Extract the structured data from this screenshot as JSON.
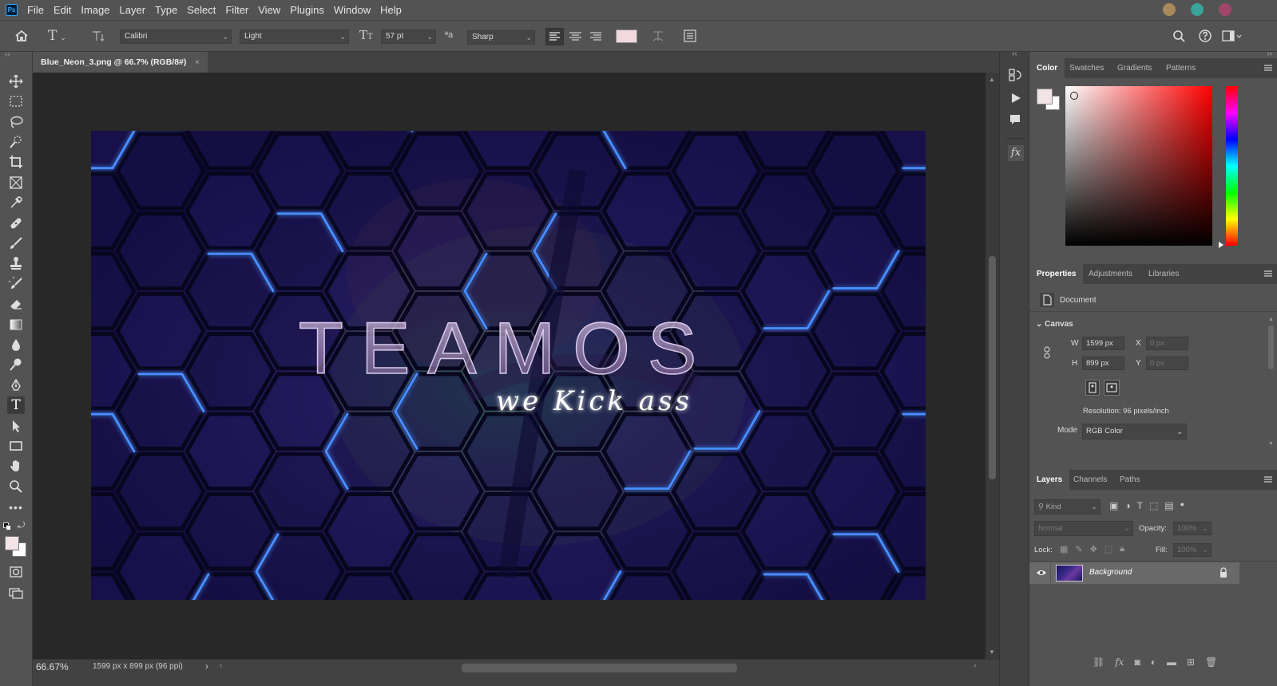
{
  "app": {
    "logo": "Ps"
  },
  "menu": [
    "File",
    "Edit",
    "Image",
    "Layer",
    "Type",
    "Select",
    "Filter",
    "View",
    "Plugins",
    "Window",
    "Help"
  ],
  "window_dots": [
    "#a88a5c",
    "#3aa39a",
    "#a1466b"
  ],
  "options": {
    "font_family": "Calibri",
    "font_style": "Light",
    "font_size": "57 pt",
    "antialias": "Sharp",
    "text_color": "#f2d9dd"
  },
  "document": {
    "tab_title": "Blue_Neon_3.png @ 66.7% (RGB/8#)",
    "close": "×",
    "art_title": "TEAMOS",
    "art_subtitle": "we Kick ass"
  },
  "status": {
    "zoom": "66.67%",
    "info": "1599 px x 899 px (96 ppi)",
    "arrow": "›"
  },
  "color_panel": {
    "tabs": [
      "Color",
      "Swatches",
      "Gradients",
      "Patterns"
    ],
    "foreground": "#f2e4e6",
    "background": "#ffffff",
    "hue": "#ff0000"
  },
  "properties_panel": {
    "tabs": [
      "Properties",
      "Adjustments",
      "Libraries"
    ],
    "doc_label": "Document",
    "section": "Canvas",
    "w_label": "W",
    "w_value": "1599 px",
    "h_label": "H",
    "h_value": "899 px",
    "x_label": "X",
    "x_value": "0 px",
    "y_label": "Y",
    "y_value": "0 px",
    "resolution": "Resolution: 96 pixels/inch",
    "mode_label": "Mode",
    "mode_value": "RGB Color"
  },
  "layers_panel": {
    "tabs": [
      "Layers",
      "Channels",
      "Paths"
    ],
    "kind": "Kind",
    "blend": "Normal",
    "opacity_label": "Opacity:",
    "opacity_value": "100%",
    "lock_label": "Lock:",
    "fill_label": "Fill:",
    "fill_value": "100%",
    "layer_name": "Background"
  }
}
